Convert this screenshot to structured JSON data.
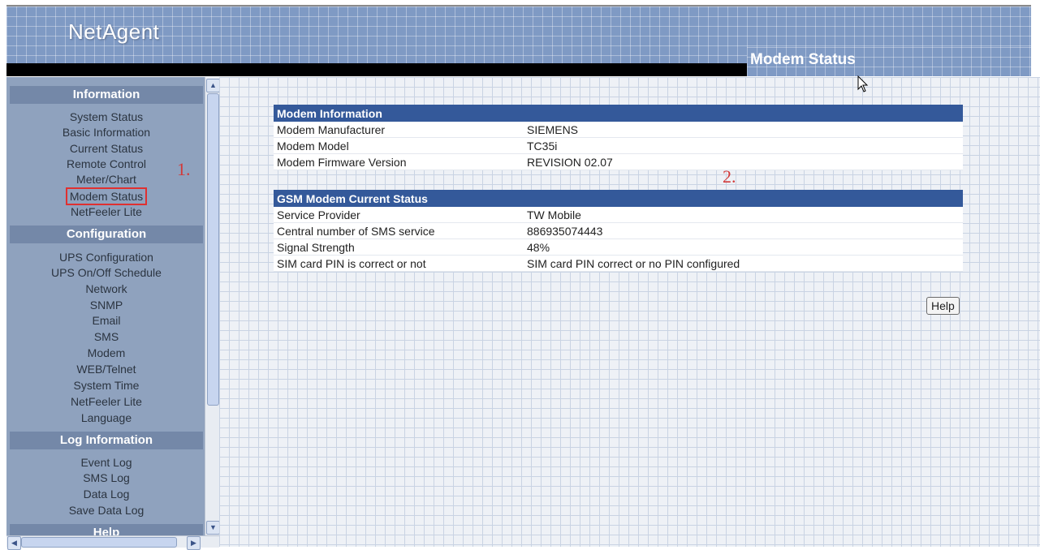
{
  "header": {
    "logo": "NetAgent",
    "page_title": "Modem Status"
  },
  "sidebar": {
    "sections": [
      {
        "title": "Information",
        "items": [
          "System Status",
          "Basic Information",
          "Current Status",
          "Remote Control",
          "Meter/Chart",
          "Modem Status",
          "NetFeeler Lite"
        ]
      },
      {
        "title": "Configuration",
        "items": [
          "UPS Configuration",
          "UPS On/Off Schedule",
          "Network",
          "SNMP",
          "Email",
          "SMS",
          "Modem",
          "WEB/Telnet",
          "System Time",
          "NetFeeler Lite",
          "Language"
        ]
      },
      {
        "title": "Log Information",
        "items": [
          "Event Log",
          "SMS Log",
          "Data Log",
          "Save Data Log"
        ]
      },
      {
        "title": "Help",
        "items": []
      }
    ],
    "selected": "Modem Status"
  },
  "modem_info": {
    "title": "Modem Information",
    "rows": [
      {
        "label": "Modem Manufacturer",
        "value": "SIEMENS"
      },
      {
        "label": "Modem Model",
        "value": "TC35i"
      },
      {
        "label": "Modem Firmware Version",
        "value": "REVISION 02.07"
      }
    ]
  },
  "gsm_status": {
    "title": "GSM Modem Current Status",
    "rows": [
      {
        "label": "Service Provider",
        "value": "TW Mobile"
      },
      {
        "label": "Central number of SMS service",
        "value": "886935074443"
      },
      {
        "label": "Signal Strength",
        "value": "48%"
      },
      {
        "label": "SIM card PIN is correct or not",
        "value": "SIM card PIN correct or no PIN configured"
      }
    ]
  },
  "help_label": "Help",
  "annotations": {
    "first": "1.",
    "second": "2."
  },
  "colors": {
    "header_blue": "#7f9ac4",
    "table_header": "#34599a",
    "sidebar_bg": "#8fa2be",
    "section_header": "#7488a8",
    "annotation_red": "#d23a3a"
  }
}
